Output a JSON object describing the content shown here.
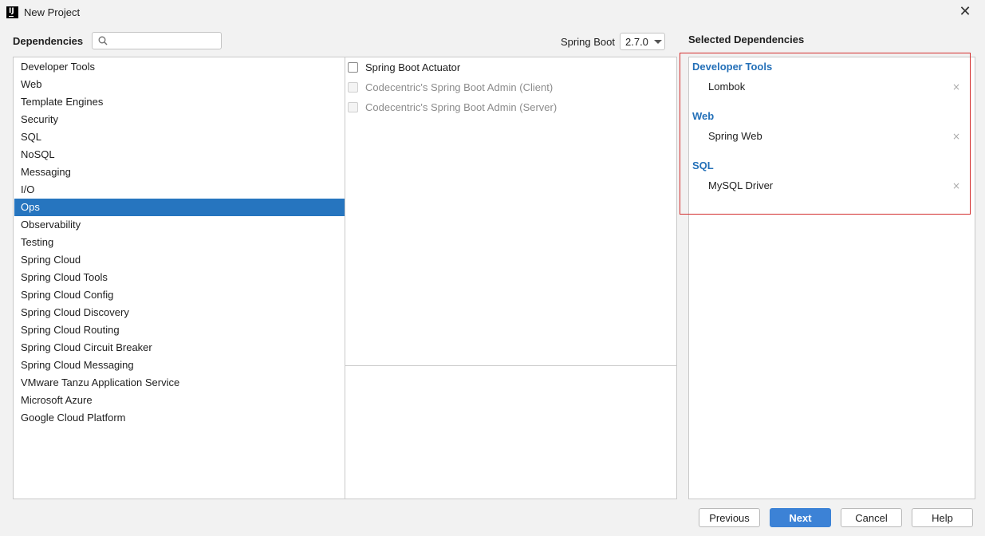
{
  "window": {
    "title": "New Project",
    "close_glyph": "✕"
  },
  "header": {
    "dependencies_label": "Dependencies",
    "search_placeholder": "",
    "search_value": "",
    "spring_boot_label": "Spring Boot",
    "spring_boot_version": "2.7.0",
    "selected_title": "Selected Dependencies"
  },
  "categories": [
    {
      "label": "Developer Tools"
    },
    {
      "label": "Web"
    },
    {
      "label": "Template Engines"
    },
    {
      "label": "Security"
    },
    {
      "label": "SQL"
    },
    {
      "label": "NoSQL"
    },
    {
      "label": "Messaging"
    },
    {
      "label": "I/O"
    },
    {
      "label": "Ops",
      "selected": true
    },
    {
      "label": "Observability"
    },
    {
      "label": "Testing"
    },
    {
      "label": "Spring Cloud"
    },
    {
      "label": "Spring Cloud Tools"
    },
    {
      "label": "Spring Cloud Config"
    },
    {
      "label": "Spring Cloud Discovery"
    },
    {
      "label": "Spring Cloud Routing"
    },
    {
      "label": "Spring Cloud Circuit Breaker"
    },
    {
      "label": "Spring Cloud Messaging"
    },
    {
      "label": "VMware Tanzu Application Service"
    },
    {
      "label": "Microsoft Azure"
    },
    {
      "label": "Google Cloud Platform"
    }
  ],
  "options": [
    {
      "label": "Spring Boot Actuator",
      "checked": false,
      "disabled": false
    },
    {
      "label": "Codecentric's Spring Boot Admin (Client)",
      "checked": false,
      "disabled": true
    },
    {
      "label": "Codecentric's Spring Boot Admin (Server)",
      "checked": false,
      "disabled": true
    }
  ],
  "selected": [
    {
      "group": "Developer Tools",
      "items": [
        "Lombok"
      ]
    },
    {
      "group": "Web",
      "items": [
        "Spring Web"
      ]
    },
    {
      "group": "SQL",
      "items": [
        "MySQL Driver"
      ]
    }
  ],
  "remove_glyph": "×",
  "buttons": {
    "previous": "Previous",
    "next": "Next",
    "cancel": "Cancel",
    "help": "Help"
  },
  "colors": {
    "selection": "#2675bf",
    "group_heading": "#2470b8",
    "primary_button": "#3c82d6",
    "highlight_border": "#d32f2f"
  },
  "icons": {
    "app": "intellij-logo-icon",
    "search": "search-icon",
    "dropdown": "chevron-down-icon",
    "close": "close-icon",
    "remove": "remove-icon"
  }
}
